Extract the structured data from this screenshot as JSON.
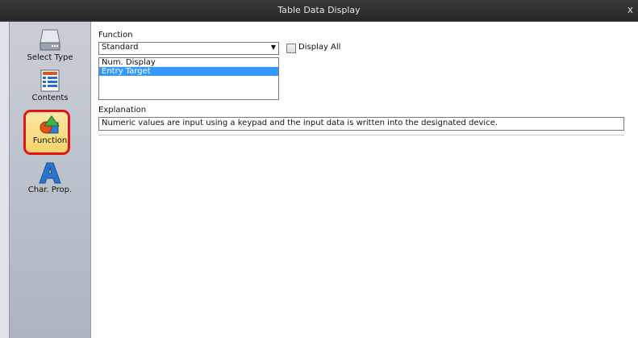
{
  "window": {
    "title": "Table Data Display",
    "close": "x"
  },
  "sidebar": {
    "items": [
      {
        "label": "Select Type",
        "icon": "drive-icon"
      },
      {
        "label": "Contents",
        "icon": "form-list-icon"
      },
      {
        "label": "Function",
        "icon": "shapes-icon",
        "selected": true
      },
      {
        "label": "Char. Prop.",
        "icon": "letter-a-icon"
      }
    ]
  },
  "function": {
    "label": "Function",
    "selected": "Standard",
    "display_all_label": "Display All",
    "display_all_checked": false,
    "list": [
      "Num. Display",
      "Entry Target"
    ],
    "list_selected": "Entry Target"
  },
  "explanation": {
    "label": "Explanation",
    "text": "Numeric values are input using a keypad and the input data is written into the designated device."
  },
  "colors": {
    "highlight": "#3399ff",
    "selection_ring": "#e0141d",
    "sidebar": "#b9c0ca"
  }
}
